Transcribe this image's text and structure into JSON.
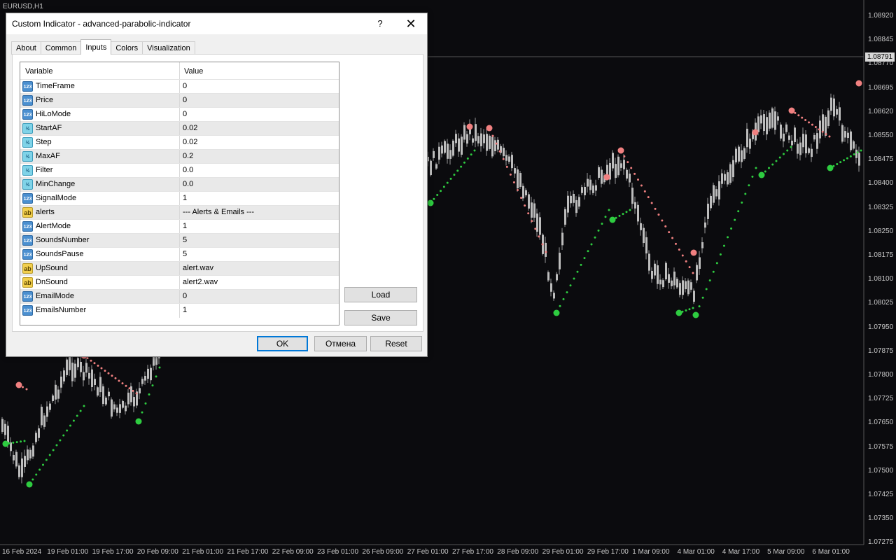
{
  "chart": {
    "symbol": "EURUSD,H1",
    "current_price": "1.08791",
    "price_ticks": [
      "1.08920",
      "1.08845",
      "1.08770",
      "1.08695",
      "1.08620",
      "1.08550",
      "1.08475",
      "1.08400",
      "1.08325",
      "1.08250",
      "1.08175",
      "1.08100",
      "1.08025",
      "1.07950",
      "1.07875",
      "1.07800",
      "1.07725",
      "1.07650",
      "1.07575",
      "1.07500",
      "1.07425",
      "1.07350",
      "1.07275"
    ],
    "time_ticks": [
      "16 Feb 2024",
      "19 Feb 01:00",
      "19 Feb 17:00",
      "20 Feb 09:00",
      "21 Feb 01:00",
      "21 Feb 17:00",
      "22 Feb 09:00",
      "23 Feb 01:00",
      "26 Feb 09:00",
      "27 Feb 01:00",
      "27 Feb 17:00",
      "28 Feb 09:00",
      "29 Feb 01:00",
      "29 Feb 17:00",
      "1 Mar 09:00",
      "4 Mar 01:00",
      "4 Mar 17:00",
      "5 Mar 09:00",
      "6 Mar 01:00"
    ],
    "colors": {
      "background": "#0b0b0e",
      "candle": "#9a9a9a",
      "sar_up": "#2ecc40",
      "sar_down": "#f08080"
    }
  },
  "dialog": {
    "title": "Custom Indicator - advanced-parabolic-indicator",
    "help_label": "?",
    "close_label": "✕",
    "tabs": [
      {
        "label": "About",
        "active": false
      },
      {
        "label": "Common",
        "active": false
      },
      {
        "label": "Inputs",
        "active": true
      },
      {
        "label": "Colors",
        "active": false
      },
      {
        "label": "Visualization",
        "active": false
      }
    ],
    "grid": {
      "col_variable": "Variable",
      "col_value": "Value",
      "rows": [
        {
          "type": "int",
          "icon": "123",
          "name": "TimeFrame",
          "value": "0"
        },
        {
          "type": "int",
          "icon": "123",
          "name": "Price",
          "value": "0"
        },
        {
          "type": "int",
          "icon": "123",
          "name": "HiLoMode",
          "value": "0"
        },
        {
          "type": "dbl",
          "icon": "½",
          "name": "StartAF",
          "value": "0.02"
        },
        {
          "type": "dbl",
          "icon": "½",
          "name": "Step",
          "value": "0.02"
        },
        {
          "type": "dbl",
          "icon": "½",
          "name": "MaxAF",
          "value": "0.2"
        },
        {
          "type": "dbl",
          "icon": "½",
          "name": "Filter",
          "value": "0.0"
        },
        {
          "type": "dbl",
          "icon": "½",
          "name": "MinChange",
          "value": "0.0"
        },
        {
          "type": "int",
          "icon": "123",
          "name": "SignalMode",
          "value": "1"
        },
        {
          "type": "str",
          "icon": "ab",
          "name": "alerts",
          "value": "--- Alerts & Emails ---"
        },
        {
          "type": "int",
          "icon": "123",
          "name": "AlertMode",
          "value": "1"
        },
        {
          "type": "int",
          "icon": "123",
          "name": "SoundsNumber",
          "value": "5"
        },
        {
          "type": "int",
          "icon": "123",
          "name": "SoundsPause",
          "value": "5"
        },
        {
          "type": "str",
          "icon": "ab",
          "name": "UpSound",
          "value": "alert.wav"
        },
        {
          "type": "str",
          "icon": "ab",
          "name": "DnSound",
          "value": "alert2.wav"
        },
        {
          "type": "int",
          "icon": "123",
          "name": "EmailMode",
          "value": "0"
        },
        {
          "type": "int",
          "icon": "123",
          "name": "EmailsNumber",
          "value": "1"
        }
      ]
    },
    "load_label": "Load",
    "save_label": "Save",
    "ok_label": "OK",
    "cancel_label": "Отмена",
    "reset_label": "Reset"
  }
}
